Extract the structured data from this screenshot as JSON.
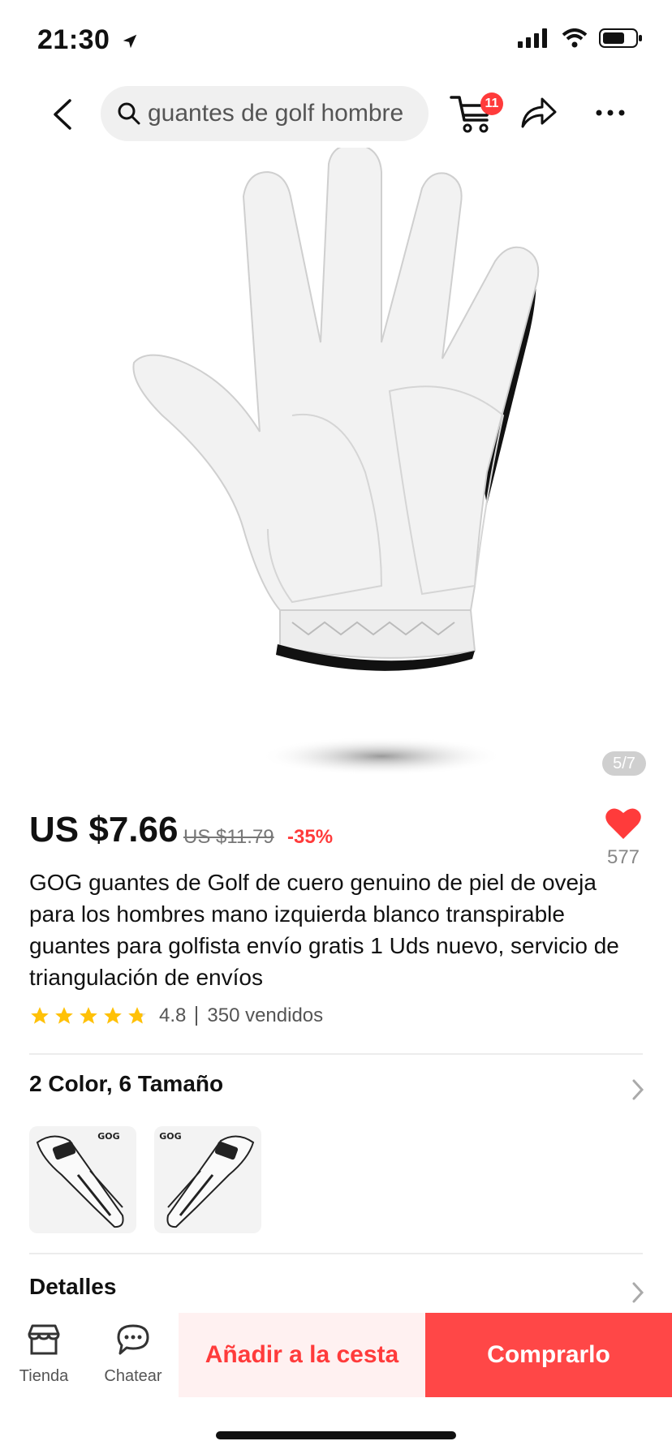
{
  "status": {
    "time": "21:30"
  },
  "nav": {
    "search_text": "guantes de golf hombre",
    "cart_count": "11"
  },
  "image": {
    "counter": "5/7"
  },
  "product": {
    "price": "US $7.66",
    "old_price": "US $11.79",
    "discount": "-35%",
    "wishlist_count": "577",
    "title": "GOG guantes de Golf de cuero genuino de piel de oveja para los hombres mano izquierda blanco transpirable guantes para golfista envío gratis 1 Uds nuevo, servicio de triangulación de envíos",
    "rating": "4.8",
    "rating_value": 4.8,
    "sold": "350 vendidos"
  },
  "variants": {
    "label": "2 Color, 6 Tamaño",
    "thumb_logo": "GOG"
  },
  "details": {
    "label": "Detalles"
  },
  "bottom": {
    "store_label": "Tienda",
    "chat_label": "Chatear",
    "add_to_cart": "Añadir a la cesta",
    "buy_now": "Comprarlo"
  },
  "colors": {
    "accent": "#ff4747",
    "accent_light": "#fff1f1",
    "star": "#ffc107",
    "wishlist": "#ff3b3b"
  }
}
